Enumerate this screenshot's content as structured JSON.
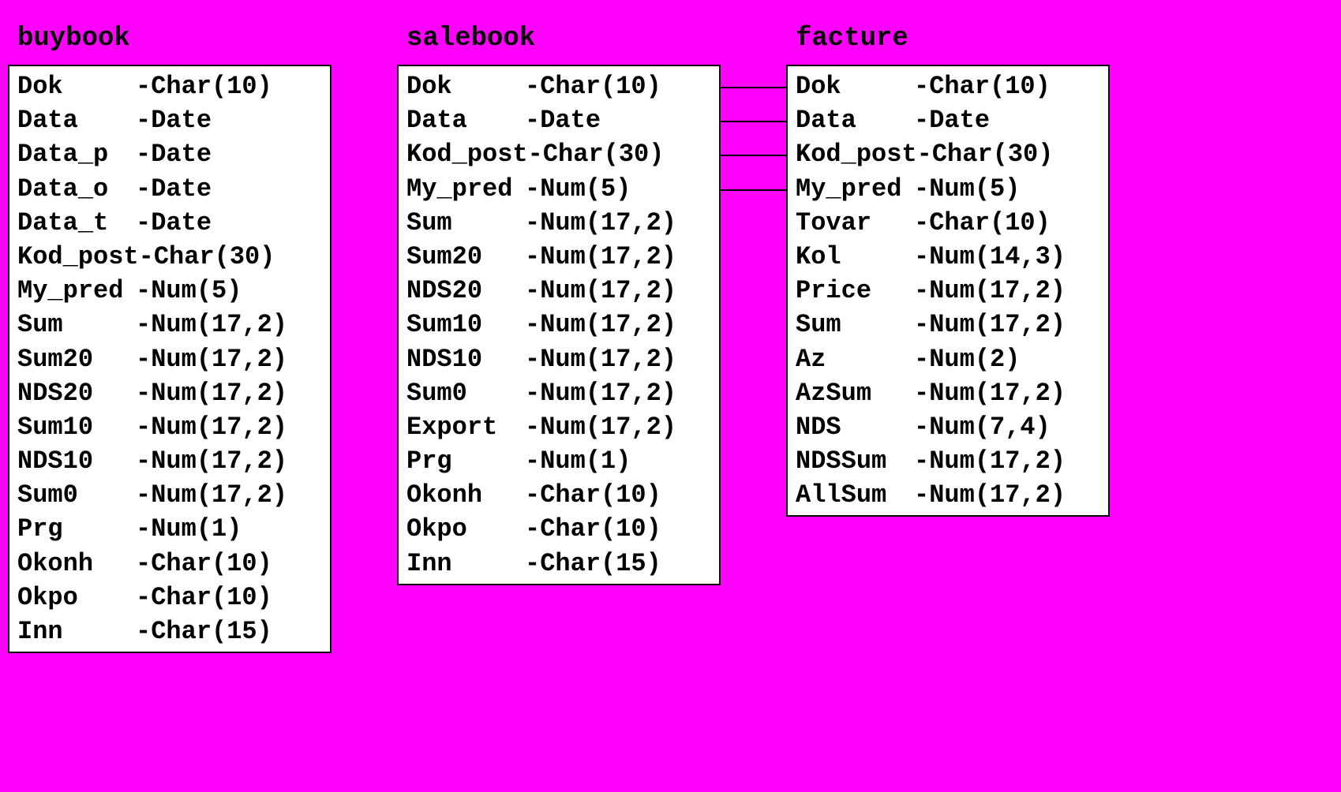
{
  "entities": {
    "buybook": {
      "title": "buybook",
      "fields": [
        {
          "name": "Dok",
          "type": "-Char(10)"
        },
        {
          "name": "Data",
          "type": "-Date"
        },
        {
          "name": "Data_p",
          "type": "-Date"
        },
        {
          "name": "Data_o",
          "type": "-Date"
        },
        {
          "name": "Data_t",
          "type": "-Date"
        },
        {
          "name": "Kod_post",
          "type": "-Char(30)"
        },
        {
          "name": "My_pred",
          "type": "-Num(5)"
        },
        {
          "name": "Sum",
          "type": "-Num(17,2)"
        },
        {
          "name": "Sum20",
          "type": "-Num(17,2)"
        },
        {
          "name": "NDS20",
          "type": "-Num(17,2)"
        },
        {
          "name": "Sum10",
          "type": "-Num(17,2)"
        },
        {
          "name": "NDS10",
          "type": "-Num(17,2)"
        },
        {
          "name": "Sum0",
          "type": "-Num(17,2)"
        },
        {
          "name": "Prg",
          "type": "-Num(1)"
        },
        {
          "name": "Okonh",
          "type": "-Char(10)"
        },
        {
          "name": "Okpo",
          "type": "-Char(10)"
        },
        {
          "name": "Inn",
          "type": "-Char(15)"
        }
      ]
    },
    "salebook": {
      "title": "salebook",
      "fields": [
        {
          "name": "Dok",
          "type": "-Char(10)"
        },
        {
          "name": "Data",
          "type": "-Date"
        },
        {
          "name": "Kod_post",
          "type": "-Char(30)"
        },
        {
          "name": "My_pred",
          "type": "-Num(5)"
        },
        {
          "name": "Sum",
          "type": "-Num(17,2)"
        },
        {
          "name": "Sum20",
          "type": "-Num(17,2)"
        },
        {
          "name": "NDS20",
          "type": "-Num(17,2)"
        },
        {
          "name": "Sum10",
          "type": "-Num(17,2)"
        },
        {
          "name": "NDS10",
          "type": "-Num(17,2)"
        },
        {
          "name": "Sum0",
          "type": "-Num(17,2)"
        },
        {
          "name": "Export",
          "type": "-Num(17,2)"
        },
        {
          "name": "Prg",
          "type": "-Num(1)"
        },
        {
          "name": "Okonh",
          "type": "-Char(10)"
        },
        {
          "name": "Okpo",
          "type": "-Char(10)"
        },
        {
          "name": "Inn",
          "type": "-Char(15)"
        }
      ]
    },
    "facture": {
      "title": "facture",
      "fields": [
        {
          "name": "Dok",
          "type": "-Char(10)"
        },
        {
          "name": "Data",
          "type": "-Date"
        },
        {
          "name": "Kod_post",
          "type": "-Char(30)"
        },
        {
          "name": "My_pred",
          "type": "-Num(5)"
        },
        {
          "name": "Tovar",
          "type": "-Char(10)"
        },
        {
          "name": "Kol",
          "type": "-Num(14,3)"
        },
        {
          "name": "Price",
          "type": "-Num(17,2)"
        },
        {
          "name": "Sum",
          "type": "-Num(17,2)"
        },
        {
          "name": "Az",
          "type": "-Num(2)"
        },
        {
          "name": "AzSum",
          "type": "-Num(17,2)"
        },
        {
          "name": "NDS",
          "type": "-Num(7,4)"
        },
        {
          "name": "NDSSum",
          "type": "-Num(17,2)"
        },
        {
          "name": "AllSum",
          "type": "-Num(17,2)"
        }
      ]
    }
  },
  "relations": [
    {
      "from": "salebook",
      "to": "facture",
      "field": "Dok"
    },
    {
      "from": "salebook",
      "to": "facture",
      "field": "Data"
    },
    {
      "from": "salebook",
      "to": "facture",
      "field": "Kod_post"
    },
    {
      "from": "salebook",
      "to": "facture",
      "field": "My_pred"
    }
  ]
}
